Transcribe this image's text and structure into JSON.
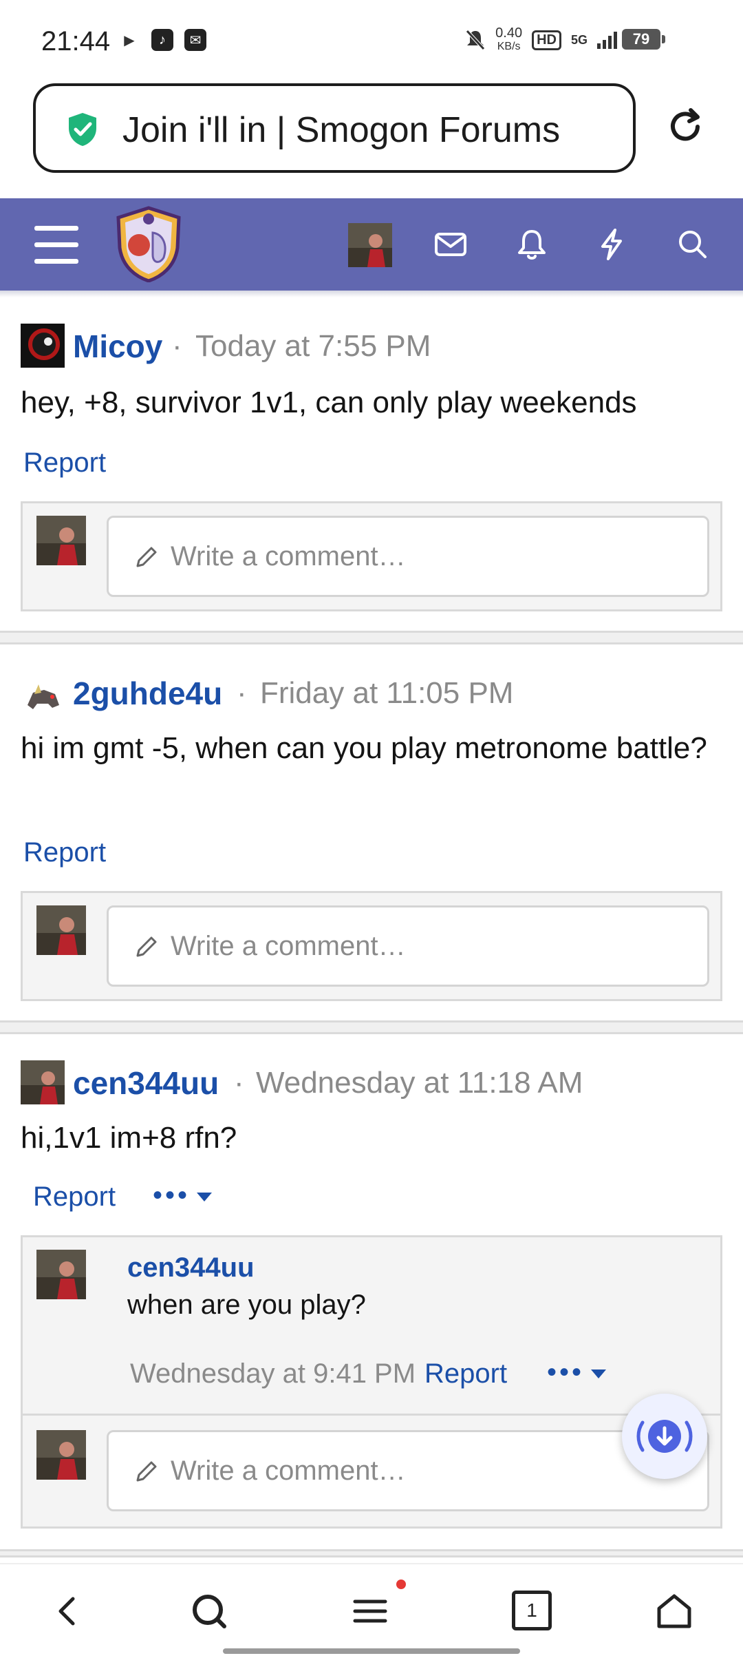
{
  "status_bar": {
    "time": "21:44",
    "network_speed_value": "0.40",
    "network_speed_unit": "KB/s",
    "hd_label": "HD",
    "network_type": "5G",
    "battery": "79"
  },
  "address_bar": {
    "title": "Join i'll in | Smogon Forums"
  },
  "colors": {
    "header_bg": "#6167b0",
    "link": "#1b4fa8",
    "meta": "#8a8a8a"
  },
  "posts": [
    {
      "username": "Micoy",
      "timestamp": "Today at 7:55 PM",
      "body": "hey, +8, survivor 1v1, can only play weekends",
      "report_label": "Report",
      "comment_placeholder": "Write a comment…"
    },
    {
      "username": "2guhde4u",
      "timestamp": "Friday at 11:05 PM",
      "body": "hi im gmt -5, when can you play metronome battle?",
      "report_label": "Report",
      "comment_placeholder": "Write a comment…"
    },
    {
      "username": "cen344uu",
      "timestamp": "Wednesday at 11:18 AM",
      "body": "hi,1v1 im+8 rfn?",
      "report_label": "Report",
      "more_label": "•••",
      "comment_placeholder": "Write a comment…",
      "reply": {
        "username": "cen344uu",
        "text": "when are you play?",
        "timestamp": "Wednesday at 9:41 PM",
        "report_label": "Report",
        "more_label": "•••"
      }
    }
  ],
  "separator": "·",
  "bottom_nav": {
    "tab_count": "1"
  }
}
